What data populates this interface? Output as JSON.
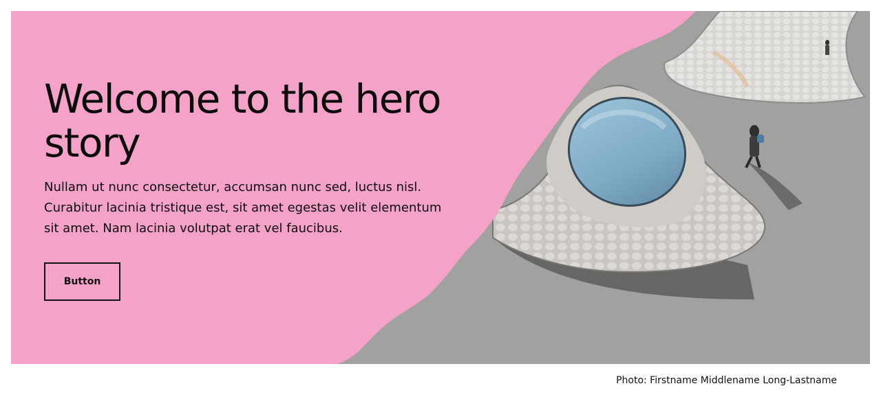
{
  "hero": {
    "title": "Welcome to the hero story",
    "body": "Nullam ut nunc consectetur, accumsan nunc sed, luctus nisl. Curabitur lacinia tristique est, sit amet egestas velit elementum sit amet. Nam lacinia volutpat erat vel faucibus.",
    "button_label": "Button",
    "background_color": "#f4a2c7"
  },
  "photo": {
    "caption": "Photo: Firstname Middlename Long-Lastname"
  }
}
